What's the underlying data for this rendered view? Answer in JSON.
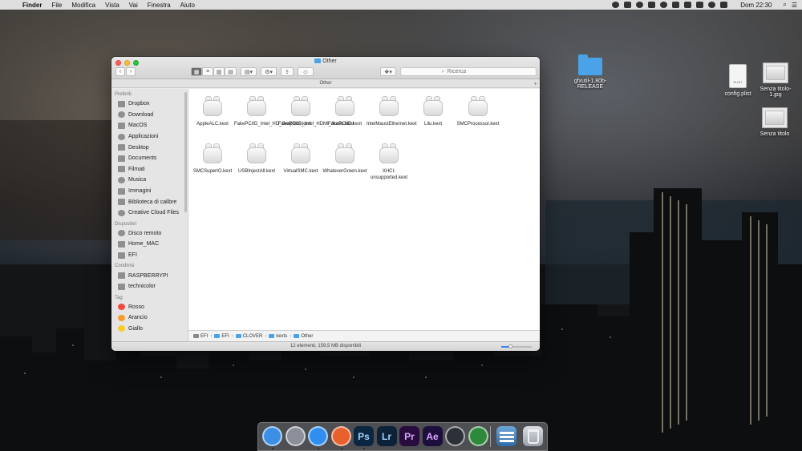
{
  "menubar": {
    "app_name": "Finder",
    "items": [
      "File",
      "Modifica",
      "Vista",
      "Vai",
      "Finestra",
      "Aiuto"
    ],
    "clock": "Dom 22:30"
  },
  "desktop_icons": [
    {
      "label": "gfxutil-1.80b-RELEASE",
      "kind": "folder"
    },
    {
      "label": "config.plist",
      "kind": "plist",
      "tag": "PLIST"
    },
    {
      "label": "Senza titolo-1.jpg",
      "kind": "image"
    },
    {
      "label": "Senza titolo",
      "kind": "image"
    }
  ],
  "window": {
    "title": "Other",
    "path_title": "Other",
    "search_placeholder": "Ricerca",
    "status": "12 elementi, 159,5 MB disponibili"
  },
  "sidebar": {
    "sections": [
      {
        "title": "Preferiti",
        "items": [
          "Dropbox",
          "Download",
          "MacOS",
          "Applicazioni",
          "Desktop",
          "Documents",
          "Filmati",
          "Musica",
          "Immagini",
          "Biblioteca di calibre",
          "Creative Cloud Files"
        ]
      },
      {
        "title": "Dispositivi",
        "items": [
          "Disco remoto",
          "Home_MAC",
          "EFI"
        ]
      },
      {
        "title": "Condivisi",
        "items": [
          "RASPBERRYPI",
          "technicolor"
        ]
      },
      {
        "title": "Tag",
        "items": [
          "Rosso",
          "Arancio",
          "Giallo"
        ]
      }
    ],
    "tag_colors": [
      "#f04a42",
      "#f59b31",
      "#f5cd2d"
    ]
  },
  "files": [
    "AppleALC.kext",
    "FakePCIID_Intel_HD_Graphics.kext",
    "FakePCIID_Intel_HDMI_Audio.kext",
    "FakePCIID.kext",
    "IntelMausiEthernet.kext",
    "Lilu.kext",
    "SMCProcessor.kext",
    "SMCSuperIO.kext",
    "USBInjectAll.kext",
    "VirtualSMC.kext",
    "WhateverGreen.kext",
    "XHCI-unsupported.kext"
  ],
  "pathbar": [
    "EFI",
    "EFI",
    "CLOVER",
    "kexts",
    "Other"
  ],
  "icon_size_level": 0.3,
  "dock": {
    "apps": [
      {
        "name": "finder-icon",
        "glyph": "",
        "color": "#3d8fe6"
      },
      {
        "name": "launchpad-icon",
        "glyph": "",
        "color": "#8a8f99"
      },
      {
        "name": "safari-icon",
        "glyph": "",
        "color": "#2f8ef0"
      },
      {
        "name": "firefox-icon",
        "glyph": "",
        "color": "#e8602c"
      },
      {
        "name": "photoshop-icon",
        "glyph": "Ps",
        "color": "#0b2640"
      },
      {
        "name": "lightroom-icon",
        "glyph": "Lr",
        "color": "#0d2238"
      },
      {
        "name": "premiere-icon",
        "glyph": "Pr",
        "color": "#2a0b3d"
      },
      {
        "name": "after-effects-icon",
        "glyph": "Ae",
        "color": "#1e0e3d"
      },
      {
        "name": "davinci-resolve-icon",
        "glyph": "",
        "color": "#2c3038"
      },
      {
        "name": "app-green-icon",
        "glyph": "",
        "color": "#2e8a3a"
      }
    ],
    "right": [
      {
        "name": "downloads-stack-icon"
      },
      {
        "name": "trash-icon"
      }
    ]
  }
}
